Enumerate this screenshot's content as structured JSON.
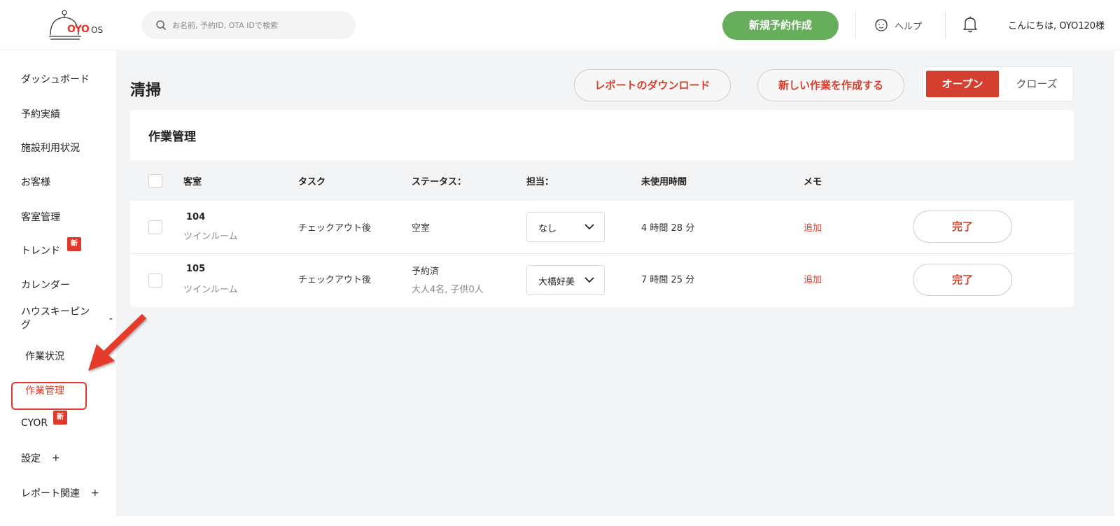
{
  "header": {
    "logo_text": "OYO",
    "logo_suffix": "OS",
    "search_placeholder": "お名前, 予約ID, OTA IDで検索",
    "new_booking_label": "新規予約作成",
    "help_label": "ヘルプ",
    "greeting": "こんにちは, OYO120様"
  },
  "sidebar": {
    "items": [
      {
        "label": "ダッシュボード"
      },
      {
        "label": "予約実績"
      },
      {
        "label": "施設利用状況"
      },
      {
        "label": "お客様"
      },
      {
        "label": "客室管理"
      },
      {
        "label": "トレンド",
        "badge": "新"
      },
      {
        "label": "カレンダー"
      },
      {
        "label": "ハウスキーピング",
        "expander": "-"
      },
      {
        "label": "作業状況"
      },
      {
        "label": "作業管理",
        "active": true
      },
      {
        "label": "CYOR",
        "badge": "新"
      },
      {
        "label": "設定",
        "expander": "+"
      },
      {
        "label": "レポート関連",
        "expander": "+"
      }
    ]
  },
  "page": {
    "title": "清掃",
    "download_report_label": "レポートのダウンロード",
    "new_task_label": "新しい作業を作成する",
    "toggle": {
      "open": "オープン",
      "close": "クローズ",
      "selected": "オープン"
    }
  },
  "card": {
    "title": "作業管理",
    "columns": [
      "客室",
      "タスク",
      "ステータス：",
      "担当：",
      "未使用時間",
      "メモ"
    ],
    "rows": [
      {
        "room": "104",
        "room_type": "ツインルーム",
        "task": "チェックアウト後",
        "status": "空室",
        "status_sub": "",
        "assignee": "なし",
        "unused_time": "4 時間 28 分",
        "memo": "追加",
        "action": "完了"
      },
      {
        "room": "105",
        "room_type": "ツインルーム",
        "task": "チェックアウト後",
        "status": "予約済",
        "status_sub": "大人4名, 子供0人",
        "assignee": "大橋好美",
        "unused_time": "7 時間 25 分",
        "memo": "追加",
        "action": "完了"
      }
    ]
  },
  "colors": {
    "accent_red": "#d3402f",
    "brand_green": "#67ae5c",
    "annotation_arrow": "#e53a2c"
  }
}
